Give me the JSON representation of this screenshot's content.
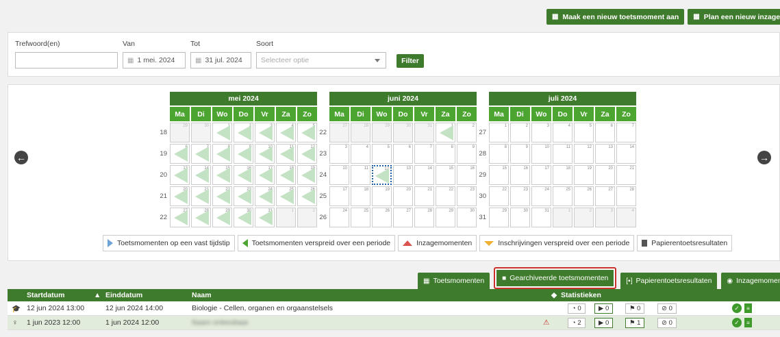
{
  "actions": {
    "new_test": "Maak een nieuw toetsmoment aan",
    "new_review": "Plan een nieuw inzagemoment"
  },
  "filter": {
    "keyword_label": "Trefwoord(en)",
    "keyword_value": "",
    "from_label": "Van",
    "from_value": "1 mei. 2024",
    "to_label": "Tot",
    "to_value": "31 jul. 2024",
    "type_label": "Soort",
    "type_placeholder": "Selecteer optie",
    "filter_button": "Filter"
  },
  "calendar": {
    "dow": [
      "Ma",
      "Di",
      "Wo",
      "Do",
      "Vr",
      "Za",
      "Zo"
    ],
    "months": [
      {
        "title": "mei 2024",
        "weeks": [
          {
            "num": "18",
            "days": [
              {
                "d": "29",
                "o": true
              },
              {
                "d": "30",
                "o": true
              },
              {
                "d": "1",
                "m": true
              },
              {
                "d": "2",
                "m": true
              },
              {
                "d": "3",
                "m": true
              },
              {
                "d": "4",
                "m": true
              },
              {
                "d": "5",
                "m": true
              }
            ]
          },
          {
            "num": "19",
            "days": [
              {
                "d": "6",
                "m": true
              },
              {
                "d": "7",
                "m": true
              },
              {
                "d": "8",
                "m": true
              },
              {
                "d": "9",
                "m": true
              },
              {
                "d": "10",
                "m": true
              },
              {
                "d": "11",
                "m": true
              },
              {
                "d": "12",
                "m": true
              }
            ]
          },
          {
            "num": "20",
            "days": [
              {
                "d": "13",
                "m": true
              },
              {
                "d": "14",
                "m": true
              },
              {
                "d": "15",
                "m": true
              },
              {
                "d": "16",
                "m": true
              },
              {
                "d": "17",
                "m": true
              },
              {
                "d": "18",
                "m": true
              },
              {
                "d": "19",
                "m": true
              }
            ]
          },
          {
            "num": "21",
            "days": [
              {
                "d": "20",
                "m": true
              },
              {
                "d": "21",
                "m": true
              },
              {
                "d": "22",
                "m": true
              },
              {
                "d": "23",
                "m": true
              },
              {
                "d": "24",
                "m": true
              },
              {
                "d": "25",
                "m": true
              },
              {
                "d": "26",
                "m": true
              }
            ]
          },
          {
            "num": "22",
            "days": [
              {
                "d": "27",
                "m": true
              },
              {
                "d": "28",
                "m": true
              },
              {
                "d": "29",
                "m": true
              },
              {
                "d": "30",
                "m": true
              },
              {
                "d": "31",
                "m": true
              },
              {
                "d": "1",
                "o": true
              },
              {
                "d": "2",
                "o": true
              }
            ]
          }
        ]
      },
      {
        "title": "juni 2024",
        "weeks": [
          {
            "num": "22",
            "days": [
              {
                "d": "27",
                "o": true
              },
              {
                "d": "28",
                "o": true
              },
              {
                "d": "29",
                "o": true
              },
              {
                "d": "30",
                "o": true
              },
              {
                "d": "31",
                "o": true
              },
              {
                "d": "1",
                "m": true
              },
              {
                "d": "2"
              }
            ]
          },
          {
            "num": "23",
            "days": [
              {
                "d": "3"
              },
              {
                "d": "4"
              },
              {
                "d": "5"
              },
              {
                "d": "6"
              },
              {
                "d": "7"
              },
              {
                "d": "8"
              },
              {
                "d": "9"
              }
            ]
          },
          {
            "num": "24",
            "days": [
              {
                "d": "10"
              },
              {
                "d": "11"
              },
              {
                "d": "12",
                "m": true,
                "t": true
              },
              {
                "d": "13"
              },
              {
                "d": "14"
              },
              {
                "d": "15"
              },
              {
                "d": "16"
              }
            ]
          },
          {
            "num": "25",
            "days": [
              {
                "d": "17"
              },
              {
                "d": "18"
              },
              {
                "d": "19"
              },
              {
                "d": "20"
              },
              {
                "d": "21"
              },
              {
                "d": "22"
              },
              {
                "d": "23"
              }
            ]
          },
          {
            "num": "26",
            "days": [
              {
                "d": "24"
              },
              {
                "d": "25"
              },
              {
                "d": "26"
              },
              {
                "d": "27"
              },
              {
                "d": "28"
              },
              {
                "d": "29"
              },
              {
                "d": "30"
              }
            ]
          }
        ]
      },
      {
        "title": "juli 2024",
        "weeks": [
          {
            "num": "27",
            "days": [
              {
                "d": "1"
              },
              {
                "d": "2"
              },
              {
                "d": "3"
              },
              {
                "d": "4"
              },
              {
                "d": "5"
              },
              {
                "d": "6"
              },
              {
                "d": "7"
              }
            ]
          },
          {
            "num": "28",
            "days": [
              {
                "d": "8"
              },
              {
                "d": "9"
              },
              {
                "d": "10"
              },
              {
                "d": "11"
              },
              {
                "d": "12"
              },
              {
                "d": "13"
              },
              {
                "d": "14"
              }
            ]
          },
          {
            "num": "29",
            "days": [
              {
                "d": "15"
              },
              {
                "d": "16"
              },
              {
                "d": "17"
              },
              {
                "d": "18"
              },
              {
                "d": "19"
              },
              {
                "d": "20"
              },
              {
                "d": "21"
              }
            ]
          },
          {
            "num": "30",
            "days": [
              {
                "d": "22"
              },
              {
                "d": "23"
              },
              {
                "d": "24"
              },
              {
                "d": "25"
              },
              {
                "d": "26"
              },
              {
                "d": "27"
              },
              {
                "d": "28"
              }
            ]
          },
          {
            "num": "31",
            "days": [
              {
                "d": "29"
              },
              {
                "d": "30"
              },
              {
                "d": "31"
              },
              {
                "d": "1",
                "o": true
              },
              {
                "d": "2",
                "o": true
              },
              {
                "d": "3",
                "o": true
              },
              {
                "d": "4",
                "o": true
              }
            ]
          }
        ]
      }
    ]
  },
  "legend": {
    "fixed": "Toetsmomenten op een vast tijdstip",
    "spread": "Toetsmomenten verspreid over een periode",
    "review": "Inzagemomenten",
    "enroll": "Inschrijvingen verspreid over een periode",
    "paper": "Papierentoetsresultaten"
  },
  "tabs": {
    "tests": "Toetsmomenten",
    "archived": "Gearchiveerde toetsmomenten",
    "paper": "Papierentoetsresultaten",
    "reviews": "Inzagemomenten"
  },
  "table": {
    "headers": {
      "start": "Startdatum",
      "end": "Einddatum",
      "name": "Naam",
      "stats": "Statistieken"
    },
    "rows": [
      {
        "start": "12 jun 2024 13:00",
        "end": "12 jun 2024 14:00",
        "name": "Biologie - Cellen, organen en orgaanstelsels",
        "s1": "0",
        "s2": "0",
        "s3": "0",
        "s4": "0"
      },
      {
        "start": "1 jun 2023 12:00",
        "end": "1 jun 2024 12:00",
        "name": "Naam onleesbaar",
        "s1": "2",
        "s2": "0",
        "s3": "1",
        "s4": "0"
      }
    ]
  },
  "colors": {
    "primary": "#3f7b2c",
    "dow": "#4ca530",
    "mark": "#c4e2c4",
    "highlight": "#c9302c"
  }
}
